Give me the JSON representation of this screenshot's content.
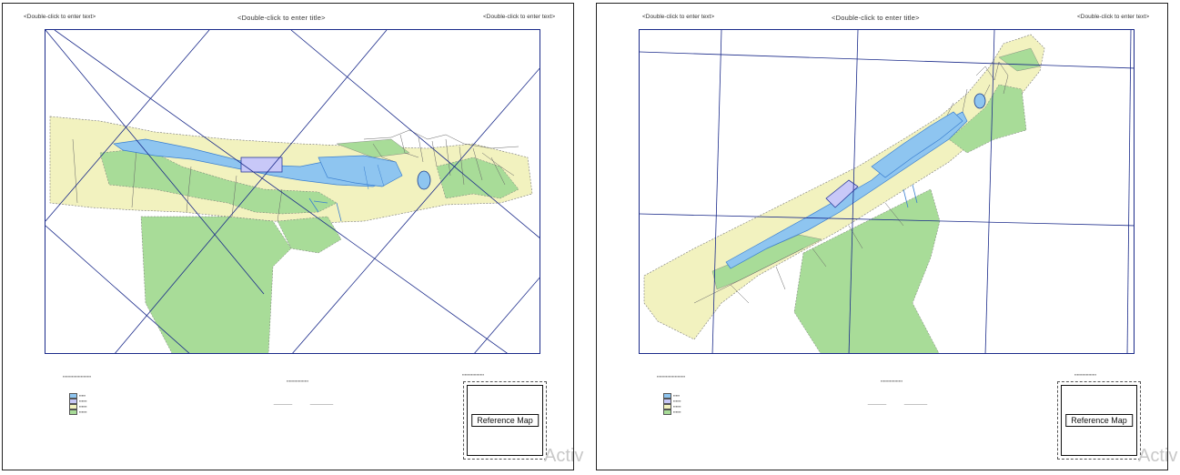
{
  "pages": [
    {
      "id": "left",
      "title": "<Double-click to enter title>",
      "header_left": "<Double-click to enter text>",
      "header_right": "<Double-click to enter text>",
      "reference_map": "Reference Map",
      "watermark": "Activ"
    },
    {
      "id": "right",
      "title": "<Double-click to enter title>",
      "header_left": "<Double-click to enter text>",
      "header_right": "<Double-click to enter text>",
      "reference_map": "Reference Map",
      "watermark": "Activ"
    }
  ],
  "colors": {
    "water": "#8ec5f0",
    "water_stroke": "#3a7fd0",
    "green": "#a8dc98",
    "yellow": "#f0f0b8",
    "grid": "#1a2a8a",
    "roads": "#555555",
    "building": "#c8c8f8"
  }
}
